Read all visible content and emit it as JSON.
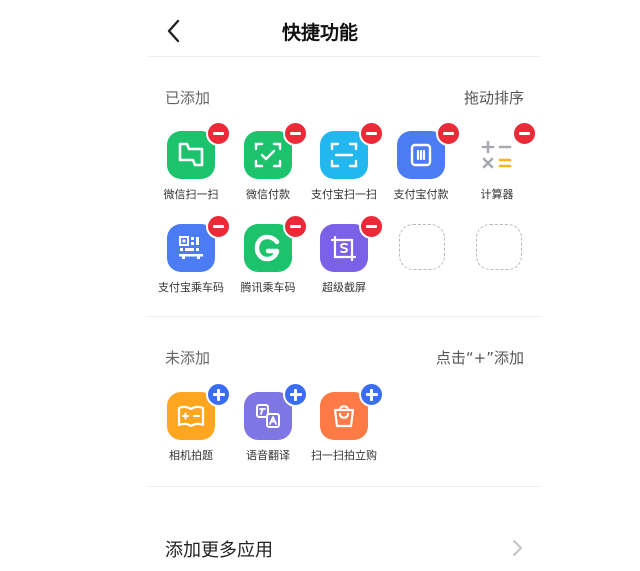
{
  "header": {
    "title": "快捷功能"
  },
  "added": {
    "title": "已添加",
    "hint": "拖动排序",
    "items": [
      {
        "label": "微信扫一扫",
        "icon": "wechat-scan-icon",
        "color": "#1dc26c"
      },
      {
        "label": "微信付款",
        "icon": "wechat-pay-icon",
        "color": "#1dc26c"
      },
      {
        "label": "支付宝扫一扫",
        "icon": "alipay-scan-icon",
        "color": "#23b7ef"
      },
      {
        "label": "支付宝付款",
        "icon": "alipay-pay-icon",
        "color": "#4c7cf3"
      },
      {
        "label": "计算器",
        "icon": "calculator-icon",
        "color": "#ffffff"
      },
      {
        "label": "支付宝乘车码",
        "icon": "alipay-bus-code-icon",
        "color": "#4c7cf3"
      },
      {
        "label": "腾讯乘车码",
        "icon": "tencent-bus-code-icon",
        "color": "#1dc26c"
      },
      {
        "label": "超级截屏",
        "icon": "super-screenshot-icon",
        "color": "#7b61e8"
      }
    ]
  },
  "not_added": {
    "title": "未添加",
    "hint": "点击“+”添加",
    "items": [
      {
        "label": "相机拍题",
        "icon": "camera-question-icon",
        "color": "#ffa51f"
      },
      {
        "label": "语音翻译",
        "icon": "voice-translate-icon",
        "color": "#7f76e6"
      },
      {
        "label": "扫一扫拍立购",
        "icon": "scan-shop-icon",
        "color": "#ff7a45"
      }
    ]
  },
  "more": {
    "label": "添加更多应用"
  }
}
